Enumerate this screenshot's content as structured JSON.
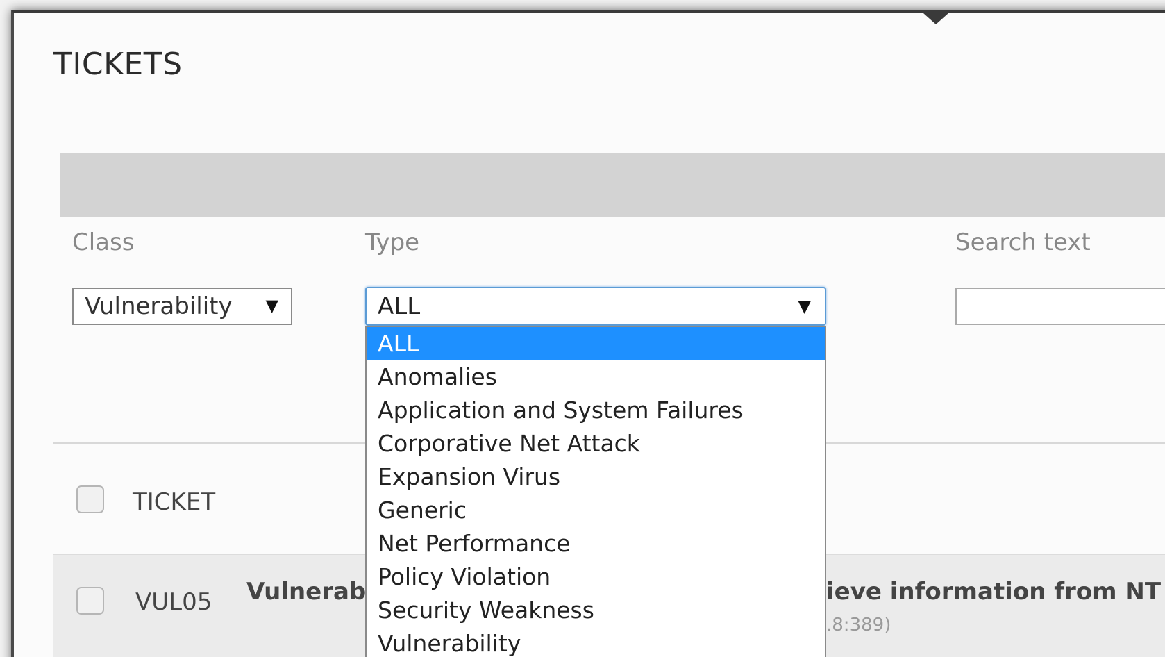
{
  "page": {
    "title": "TICKETS"
  },
  "filters": {
    "class_label": "Class",
    "class_value": "Vulnerability",
    "type_label": "Type",
    "type_value": "ALL",
    "search_label": "Search text",
    "search_value": ""
  },
  "type_dropdown": {
    "options": [
      "ALL",
      "Anomalies",
      "Application and System Failures",
      "Corporative Net Attack",
      "Expansion Virus",
      "Generic",
      "Net Performance",
      "Policy Violation",
      "Security Weakness",
      "Vulnerability"
    ],
    "selected_index": 0,
    "highlight_color": "#1e90ff"
  },
  "table": {
    "header_ticket": "TICKET",
    "rows": [
      {
        "id": "VUL05",
        "title_left": "Vulnerabi",
        "title_right": "ieve information from NT D",
        "subtitle": ".8:389)"
      }
    ]
  },
  "icons": {
    "select_arrow": "▼"
  }
}
